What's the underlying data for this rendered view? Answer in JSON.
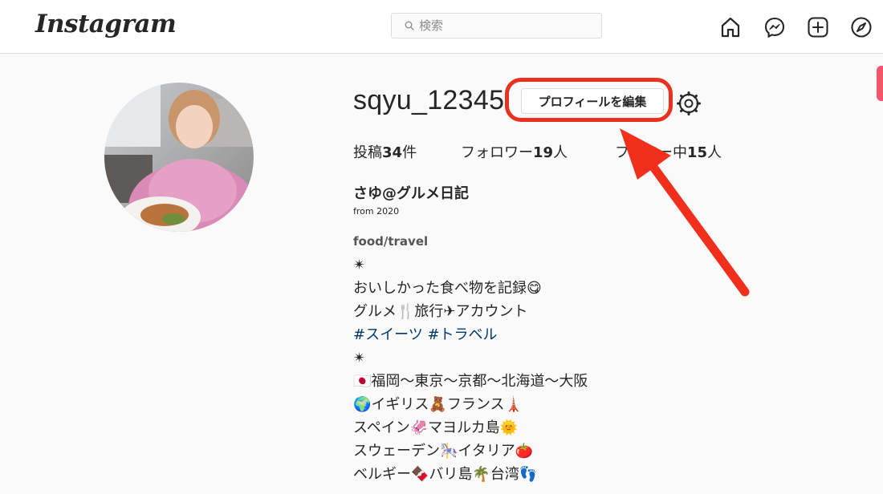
{
  "header": {
    "logo_text": "Instagram",
    "search_placeholder": "検索",
    "icons": [
      "home-icon",
      "messenger-icon",
      "new-post-icon",
      "explore-icon"
    ]
  },
  "profile": {
    "username": "sqyu_12345",
    "edit_button_label": "プロフィールを編集",
    "stats": [
      {
        "label": "投稿",
        "count": "34",
        "suffix": "件"
      },
      {
        "label": "フォロワー",
        "count": "19",
        "suffix": "人"
      },
      {
        "label": "フォロー中",
        "count": "15",
        "suffix": "人"
      }
    ],
    "display_name": "さゆ@グルメ日記",
    "since": "from 2020",
    "bio_lines": [
      "food/travel",
      "✴",
      "おいしかった食べ物を記録😋",
      "グルメ🍴旅行✈アカウント",
      "#スイーツ #トラベル",
      "✴",
      "🇯🇵福岡〜東京〜京都〜北海道〜大阪",
      "🌍イギリス🧸フランス🗼",
      "スペイン🦑マヨルカ島🌞",
      "スウェーデン🎠イタリア🍅",
      "ベルギー🍫バリ島🌴台湾👣"
    ]
  },
  "colors": {
    "accent_red": "#e8321f",
    "hashtag_blue": "#00376b",
    "border": "#dbdbdb",
    "background": "#fafafa"
  }
}
